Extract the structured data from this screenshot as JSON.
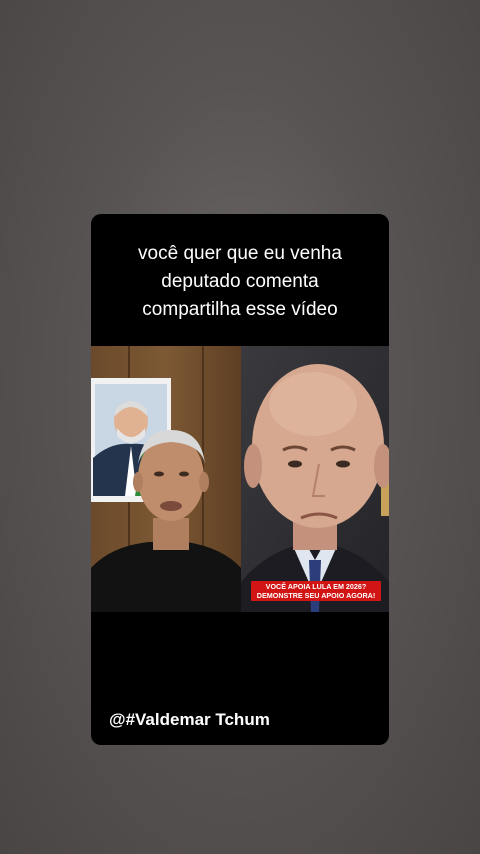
{
  "video": {
    "caption_lines": [
      "você quer que eu venha",
      "deputado comenta",
      "compartilha esse vídeo"
    ],
    "banner_lines": [
      "VOCÊ APOIA LULA EM 2026?",
      "DEMONSTRE SEU APOIO AGORA!"
    ],
    "credit": "@#Valdemar Tchum"
  },
  "colors": {
    "background": "#595454",
    "card": "#000000",
    "banner": "#d11414",
    "text": "#ffffff"
  }
}
